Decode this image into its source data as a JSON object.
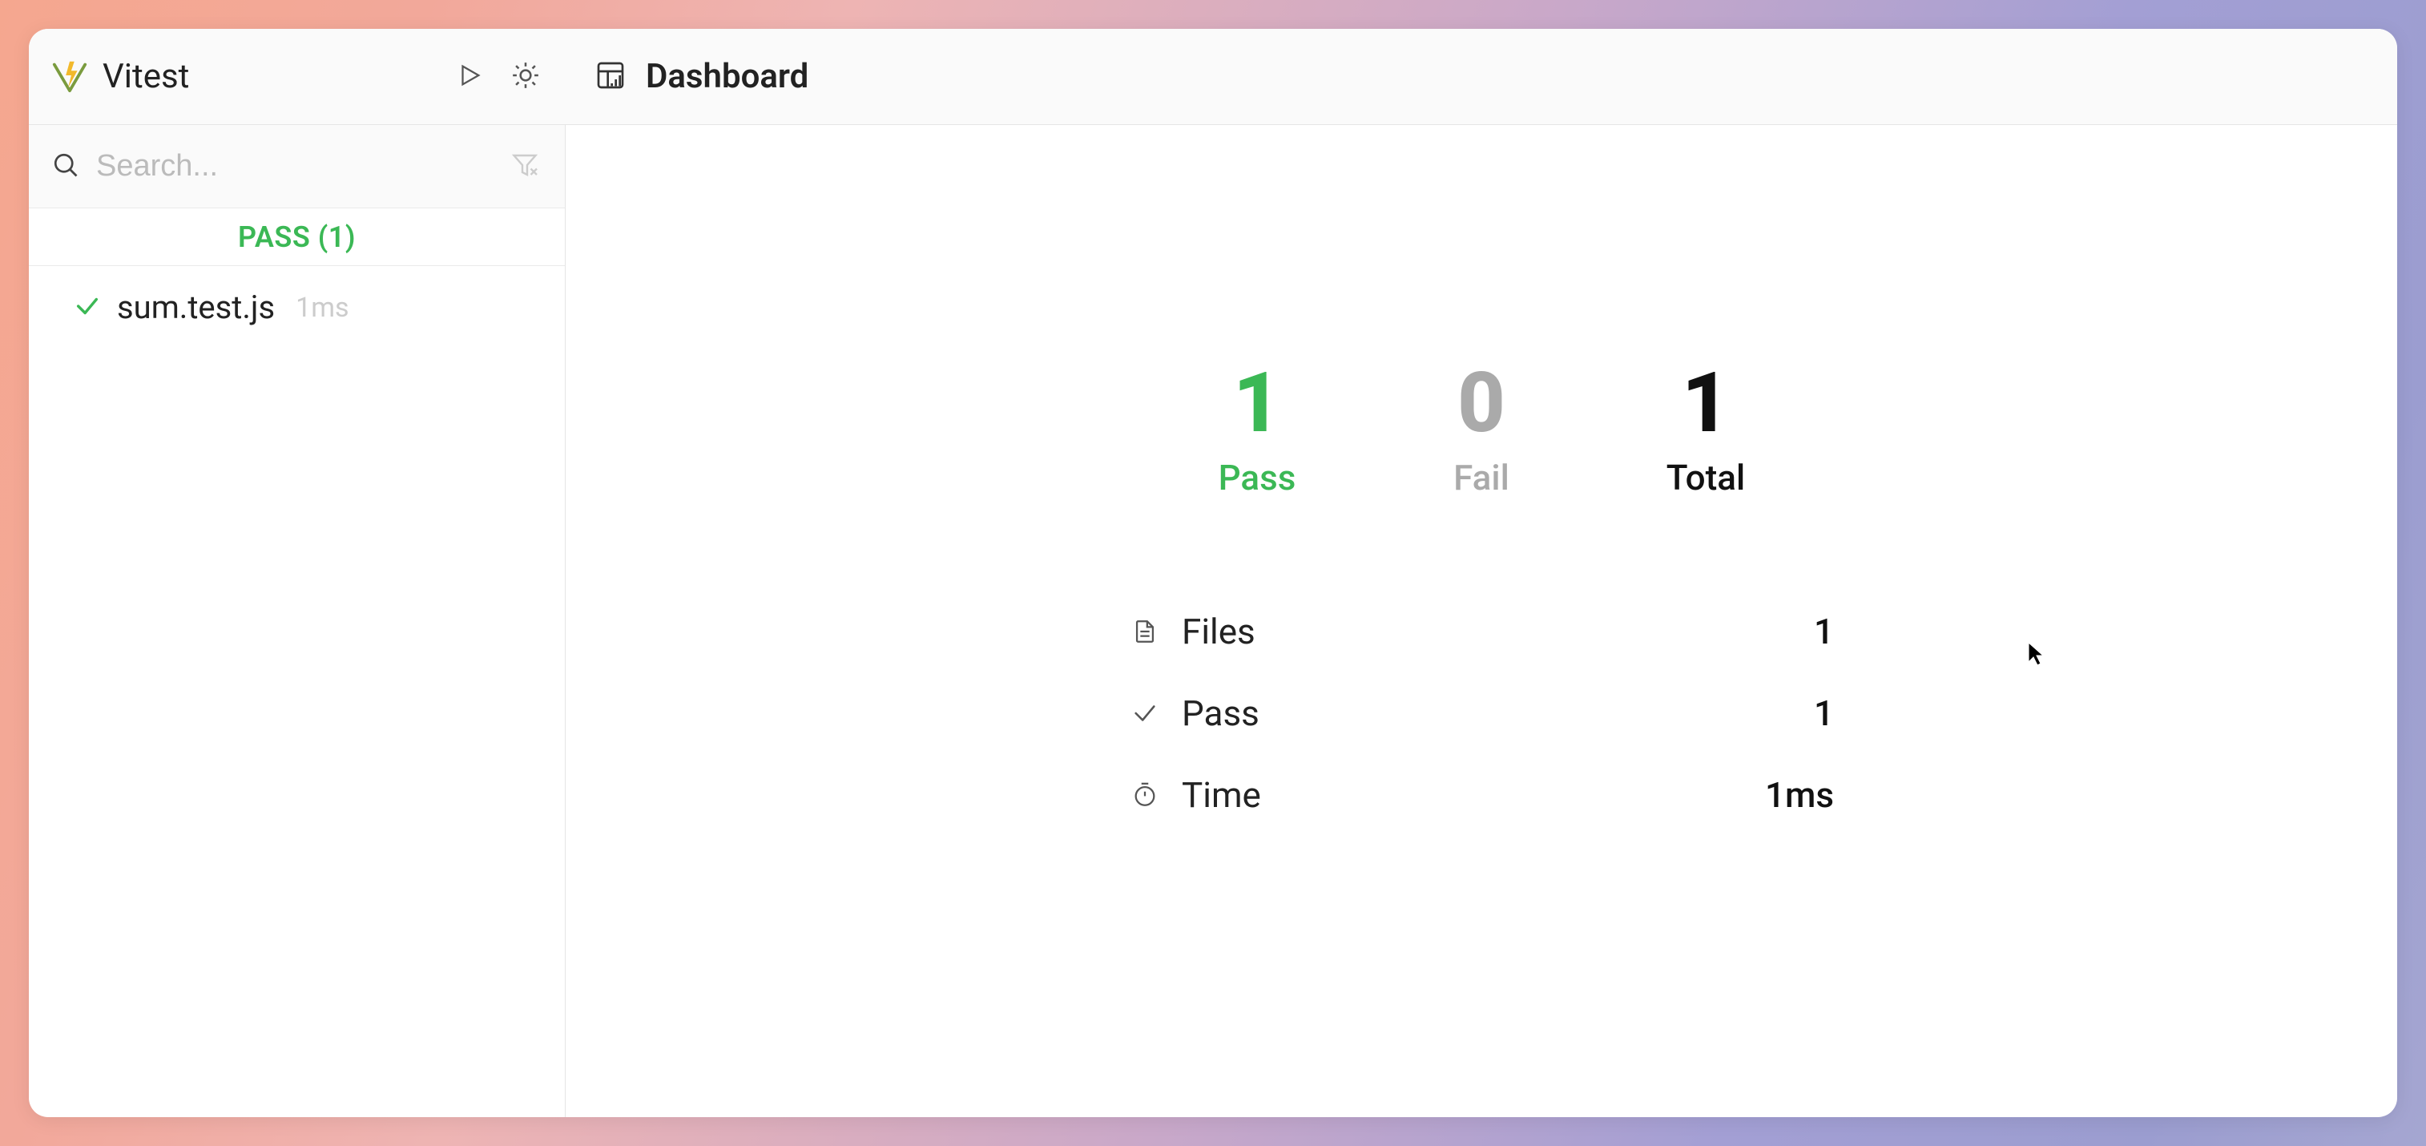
{
  "sidebar": {
    "app_title": "Vitest",
    "search_placeholder": "Search...",
    "status_bar": "PASS (1)",
    "tests": [
      {
        "name": "sum.test.js",
        "time": "1ms"
      }
    ]
  },
  "header": {
    "page_title": "Dashboard"
  },
  "dashboard": {
    "stats": {
      "pass_value": "1",
      "pass_label": "Pass",
      "fail_value": "0",
      "fail_label": "Fail",
      "total_value": "1",
      "total_label": "Total"
    },
    "details": {
      "files_label": "Files",
      "files_value": "1",
      "pass_label": "Pass",
      "pass_value": "1",
      "time_label": "Time",
      "time_value": "1ms"
    }
  }
}
